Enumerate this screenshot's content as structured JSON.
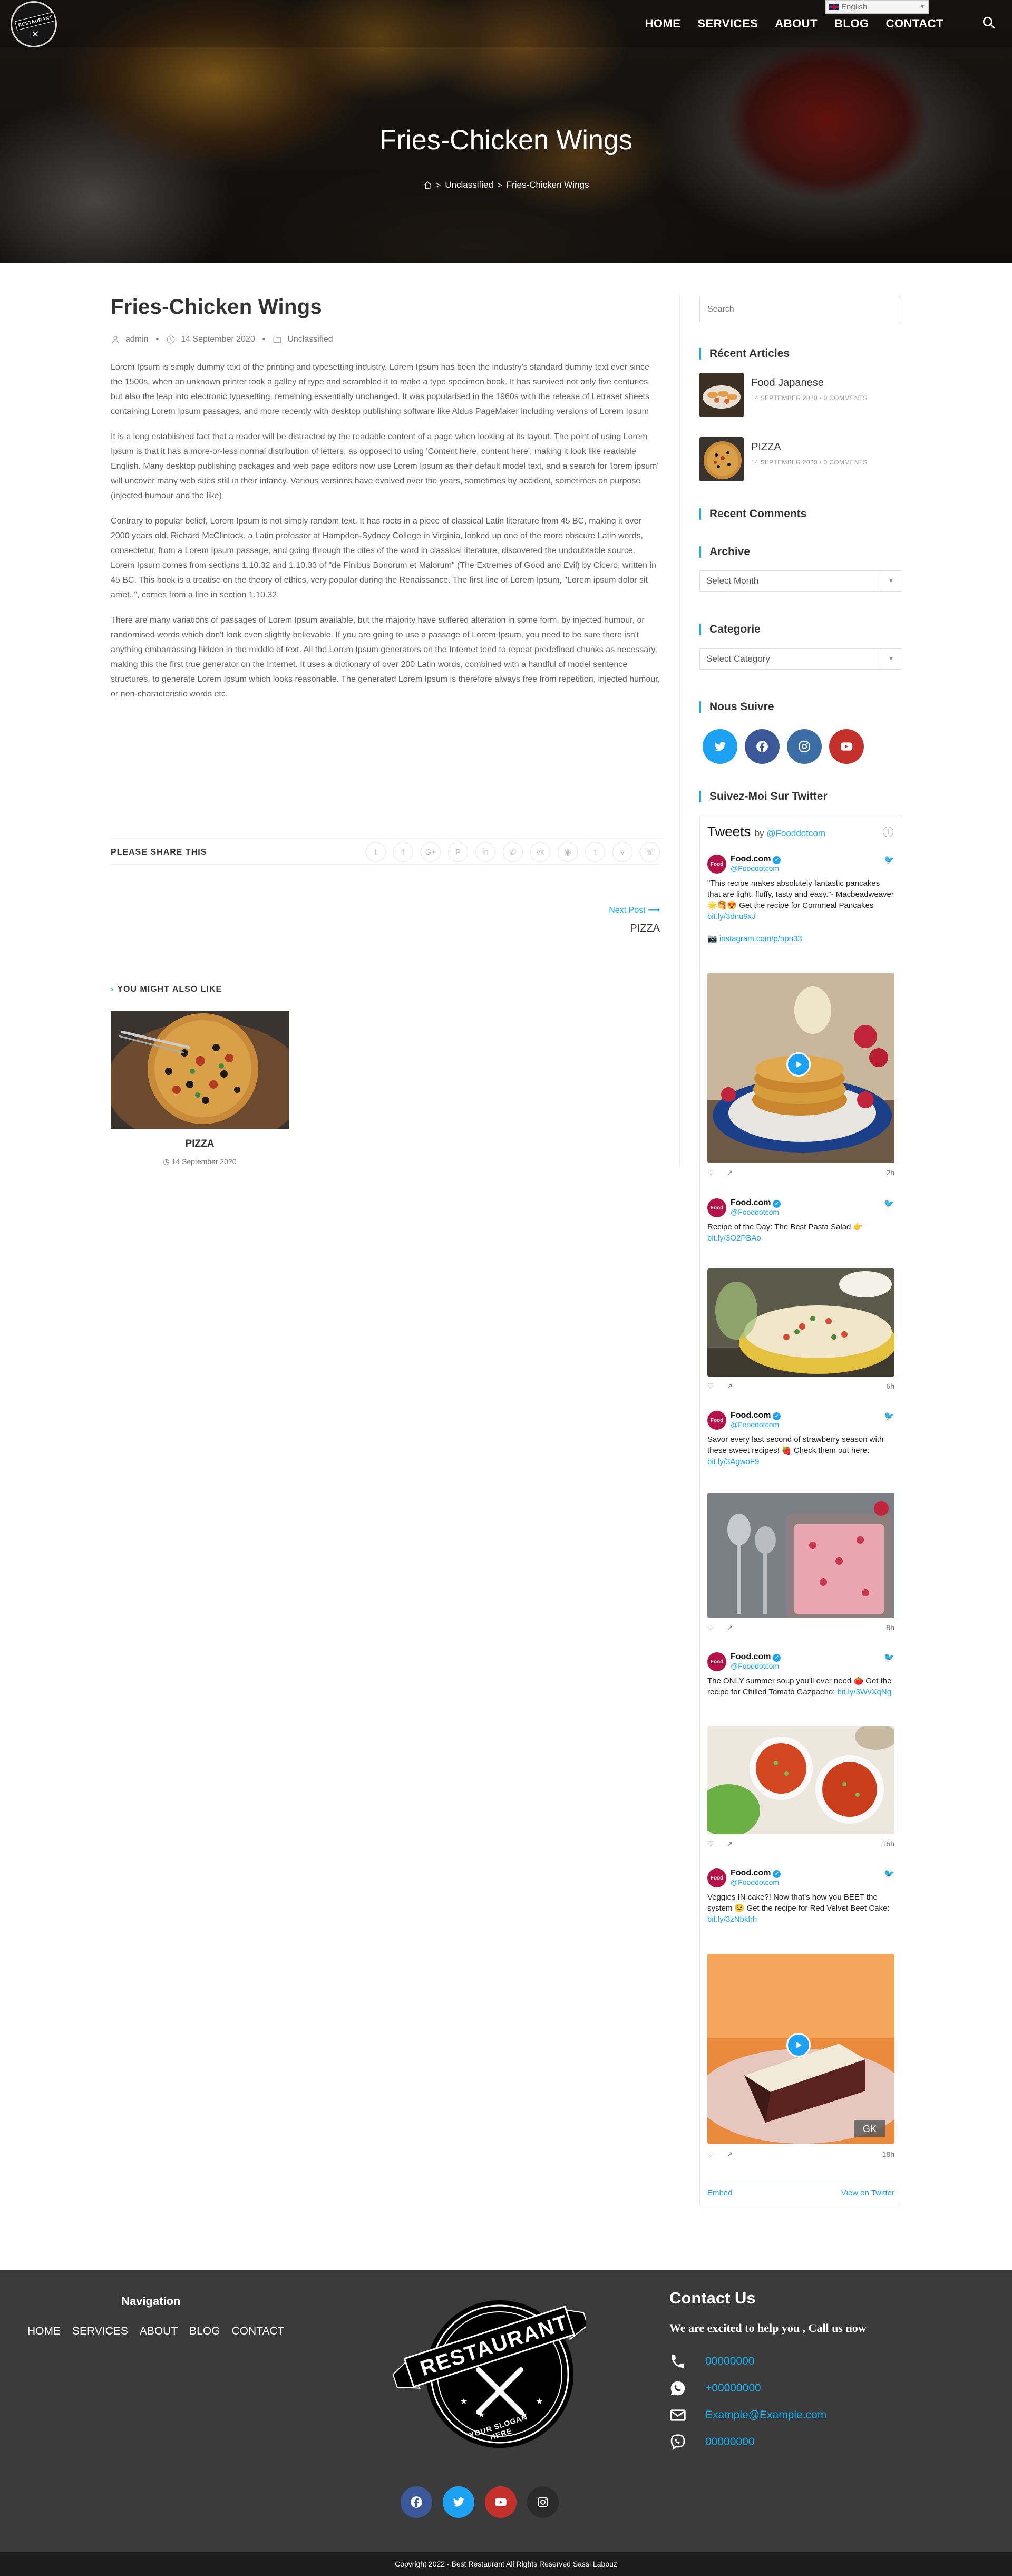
{
  "nav": {
    "language": "English",
    "menu": [
      "HOME",
      "SERVICES",
      "ABOUT",
      "BLOG",
      "CONTACT"
    ],
    "logo_text": "RESTAURANT"
  },
  "hero": {
    "title": "Fries-Chicken Wings",
    "breadcrumb": [
      "Unclassified",
      "Fries-Chicken Wings"
    ]
  },
  "post": {
    "title": "Fries-Chicken Wings",
    "author": "admin",
    "date": "14 September 2020",
    "category": "Unclassified",
    "paragraphs": [
      "Lorem Ipsum is simply dummy text of the printing and typesetting industry. Lorem Ipsum has been the industry's standard dummy text ever since the 1500s, when an unknown printer took a galley of type and scrambled it to make a type specimen book. It has survived not only five centuries, but also the leap into electronic typesetting, remaining essentially unchanged. It was popularised in the 1960s with the release of Letraset sheets containing Lorem Ipsum passages, and more recently with desktop publishing software like Aldus PageMaker including versions of Lorem Ipsum",
      "It is a long established fact that a reader will be distracted by the readable content of a page when looking at its layout. The point of using Lorem Ipsum is that it has a more-or-less normal distribution of letters, as opposed to using 'Content here, content here', making it look like readable English. Many desktop publishing packages and web page editors now use Lorem Ipsum as their default model text, and a search for 'lorem ipsum' will uncover many web sites still in their infancy. Various versions have evolved over the years, sometimes by accident, sometimes on purpose (injected humour and the like)",
      "Contrary to popular belief, Lorem Ipsum is not simply random text. It has roots in a piece of classical Latin literature from 45 BC, making it over 2000 years old. Richard McClintock, a Latin professor at Hampden-Sydney College in Virginia, looked up one of the more obscure Latin words, consectetur, from a Lorem Ipsum passage, and going through the cites of the word in classical literature, discovered the undoubtable source. Lorem Ipsum comes from sections 1.10.32 and 1.10.33 of \"de Finibus Bonorum et Malorum\" (The Extremes of Good and Evil) by Cicero, written in 45 BC. This book is a treatise on the theory of ethics, very popular during the Renaissance. The first line of Lorem Ipsum, \"Lorem ipsum dolor sit amet..\", comes from a line in section 1.10.32.",
      "There are many variations of passages of Lorem Ipsum available, but the majority have suffered alteration in some form, by injected humour, or randomised words which don't look even slightly believable. If you are going to use a passage of Lorem Ipsum, you need to be sure there isn't anything embarrassing hidden in the middle of text. All the Lorem Ipsum generators on the Internet tend to repeat predefined chunks as necessary, making this the first true generator on the Internet. It uses a dictionary of over 200 Latin words, combined with a handful of model sentence structures, to generate Lorem Ipsum which looks reasonable. The generated Lorem Ipsum is therefore always free from repetition, injected humour, or non-characteristic words etc."
    ],
    "share_label": "PLEASE SHARE THIS",
    "share_icons": [
      "twitter-icon",
      "facebook-icon",
      "google-plus-icon",
      "pinterest-icon",
      "linkedin-icon",
      "viber-icon",
      "vk-icon",
      "reddit-icon",
      "tumblr-icon",
      "viadeo-icon",
      "whatsapp-icon"
    ],
    "next_label": "Next Post",
    "next_title": "PIZZA"
  },
  "related": {
    "heading": "YOU MIGHT ALSO LIKE",
    "title": "PIZZA",
    "date": "14 September 2020"
  },
  "sidebar": {
    "search_placeholder": "Search",
    "recent_articles_heading": "Récent Articles",
    "recent": [
      {
        "title": "Food Japanese",
        "date": "14 SEPTEMBER 2020",
        "comments": "0 COMMENTS"
      },
      {
        "title": "PIZZA",
        "date": "14 SEPTEMBER 2020",
        "comments": "0 COMMENTS"
      }
    ],
    "recent_comments_heading": "Recent Comments",
    "archive_heading": "Archive",
    "archive_select": "Select Month",
    "category_heading": "Categorie",
    "category_select": "Select Category",
    "follow_heading": "Nous Suivre",
    "twitter_heading": "Suivez-Moi Sur Twitter"
  },
  "twitter": {
    "title": "Tweets",
    "by": "by",
    "handle_link": "@Fooddotcom",
    "name": "Food.com",
    "handle": "@Fooddotcom",
    "tweets": [
      {
        "text": "\"This recipe makes absolutely fantastic pancakes that are light, fluffy, tasty and easy.\"- Macbeadweaver 🌟🥞😍 Get the recipe for Cornmeal Pancakes",
        "link": "bit.ly/3dnu9xJ",
        "extra": "instagram.com/p/npn33",
        "time": "2h"
      },
      {
        "text": "Recipe of the Day: The Best Pasta Salad 👉",
        "link": "bit.ly/3O2PBAo",
        "time": "6h"
      },
      {
        "text": "Savor every last second of strawberry season with these sweet recipes! 🍓 Check them out here:",
        "link": "bit.ly/3AgwoF9",
        "time": "8h"
      },
      {
        "text": "The ONLY summer soup you'll ever need 🍅 Get the recipe for Chilled Tomato Gazpacho:",
        "link": "bit.ly/3WvXqNg",
        "time": "16h"
      },
      {
        "text": "Veggies IN cake?! Now that's how you BEET the system 😉 Get the recipe for Red Velvet Beet Cake:",
        "link": "bit.ly/3zNbkhh",
        "time": "18h"
      }
    ],
    "embed": "Embed",
    "view_on": "View on Twitter"
  },
  "footer": {
    "nav_title": "Navigation",
    "menu": [
      "HOME",
      "SERVICES",
      "ABOUT",
      "BLOG",
      "CONTACT"
    ],
    "logo_top": "RESTAURANT",
    "logo_bottom": "YOUR SLOGAN HERE",
    "contact_title": "Contact Us",
    "contact_sub": "We are excited to help you , Call us now",
    "phone": "00000000",
    "whatsapp": "+00000000",
    "email": "Example@Example.com",
    "viber": "00000000",
    "copyright": "Copyright 2022 - Best Restaurant All Rights Reserved Sassi Labouz"
  },
  "colors": {
    "accent": "#13aff0",
    "footer_bg": "#3b3b3b",
    "facebook": "#3b5998",
    "twitter": "#1da1f2",
    "youtube": "#c4302b",
    "instagram": "#333333"
  }
}
